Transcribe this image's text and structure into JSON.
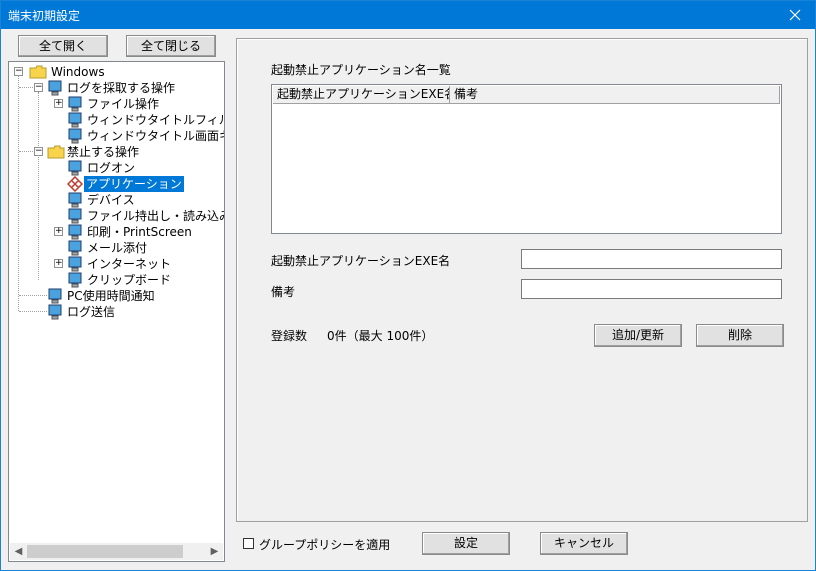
{
  "window": {
    "title": "端末初期設定"
  },
  "tree_buttons": {
    "expand_all": "全て開く",
    "collapse_all": "全て閉じる"
  },
  "tree": {
    "root": "Windows",
    "items": [
      {
        "label": "ログを採取する操作",
        "icon": "monitor-icon"
      },
      {
        "label": "ファイル操作",
        "icon": "monitor-icon"
      },
      {
        "label": "ウィンドウタイトルフィルタ",
        "icon": "monitor-icon"
      },
      {
        "label": "ウィンドウタイトル画面キャ",
        "icon": "monitor-icon"
      },
      {
        "label": "禁止する操作",
        "icon": "folder-icon"
      },
      {
        "label": "ログオン",
        "icon": "monitor-icon"
      },
      {
        "label": "アプリケーション",
        "icon": "prohibited-app-icon",
        "selected": true
      },
      {
        "label": "デバイス",
        "icon": "monitor-icon"
      },
      {
        "label": "ファイル持出し・読み込み",
        "icon": "monitor-icon"
      },
      {
        "label": "印刷・PrintScreen",
        "icon": "monitor-icon"
      },
      {
        "label": "メール添付",
        "icon": "monitor-icon"
      },
      {
        "label": "インターネット",
        "icon": "monitor-icon"
      },
      {
        "label": "クリップボード",
        "icon": "monitor-icon"
      },
      {
        "label": "PC使用時間通知",
        "icon": "monitor-icon"
      },
      {
        "label": "ログ送信",
        "icon": "monitor-icon"
      }
    ]
  },
  "panel": {
    "list_title": "起動禁止アプリケーション名一覧",
    "columns": [
      "起動禁止アプリケーションEXE名",
      "備考"
    ],
    "exe_label": "起動禁止アプリケーションEXE名",
    "exe_value": "",
    "note_label": "備考",
    "note_value": "",
    "count_label": "登録数",
    "count_value": "0件（最大 100件）",
    "add_update_button": "追加/更新",
    "delete_button": "削除"
  },
  "footer": {
    "group_policy_label": "グループポリシーを適用",
    "group_policy_checked": false,
    "ok_button": "設定",
    "cancel_button": "キャンセル"
  }
}
